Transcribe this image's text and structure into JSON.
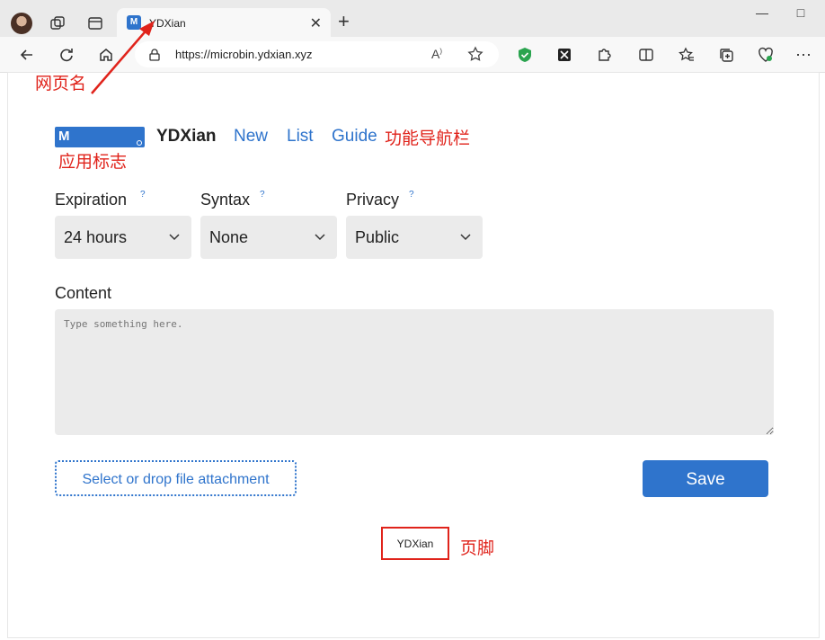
{
  "browser": {
    "tab_title": "YDXian",
    "tab_favicon": "M",
    "url": "https://microbin.ydxian.xyz",
    "min_label": "—",
    "max_label": "□"
  },
  "app": {
    "logo_glyph": "M",
    "name": "YDXian",
    "nav": [
      "New",
      "List",
      "Guide"
    ]
  },
  "form": {
    "expiration": {
      "label": "Expiration",
      "help": "?",
      "value": "24 hours"
    },
    "syntax": {
      "label": "Syntax",
      "help": "?",
      "value": "None"
    },
    "privacy": {
      "label": "Privacy",
      "help": "?",
      "value": "Public"
    },
    "content_label": "Content",
    "content_placeholder": "Type something here.",
    "attach_label": "Select or drop file attachment",
    "save_label": "Save"
  },
  "footer": {
    "text": "YDXian"
  },
  "annotations": {
    "page_name": "网页名",
    "app_logo": "应用标志",
    "nav_bar": "功能导航栏",
    "footer": "页脚"
  },
  "colors": {
    "accent": "#2f74cc",
    "annotation": "#e0231b"
  }
}
